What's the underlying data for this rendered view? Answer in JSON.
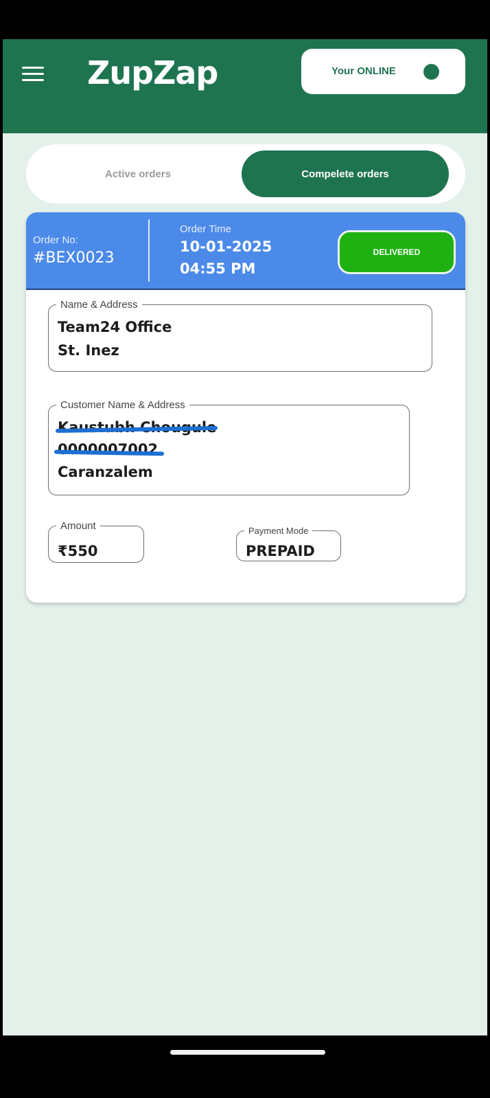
{
  "app": {
    "title": "ZupZap"
  },
  "header": {
    "menu_icon": "hamburger-menu-icon",
    "status_label": "Your ONLINE",
    "status_icon": "online-dot-icon"
  },
  "tabs": [
    {
      "label": "Active orders",
      "selected": false
    },
    {
      "label": "Compelete orders",
      "selected": true
    }
  ],
  "order": {
    "order_no_label": "Order No:",
    "order_no": "#BEX0023",
    "order_time_label": "Order Time",
    "order_date": "10-01-2025",
    "order_time": "04:55 PM",
    "status": "DELIVERED",
    "name_address_label": "Name & Address",
    "name_address_line1": "Team24 Office",
    "name_address_line2": "St. Inez",
    "customer_label": "Customer Name & Address",
    "customer_name": "Kaustubh Chougule",
    "customer_phone": "0000007002",
    "customer_address": "Caranzalem",
    "amount_label": "Amount",
    "amount": "₹550",
    "payment_label": "Payment Mode",
    "payment": "PREPAID"
  },
  "colors": {
    "brand_green": "#1f7450",
    "header_blue": "#4b8ae9",
    "delivered_green": "#1fb012",
    "background": "#e4f1ea",
    "redaction": "#1d6fd2"
  }
}
